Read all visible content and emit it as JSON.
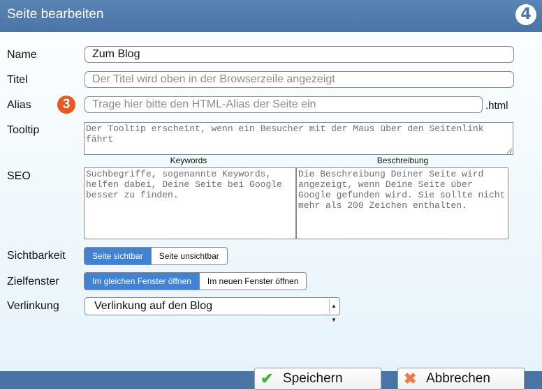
{
  "window": {
    "title": "Seite bearbeiten",
    "logo_text": "4"
  },
  "fields": {
    "name": {
      "label": "Name",
      "value": "Zum Blog"
    },
    "titel": {
      "label": "Titel",
      "placeholder": "Der Titel wird oben in der Browserzeile angezeigt"
    },
    "alias": {
      "label": "Alias",
      "placeholder": "Trage hier bitte den HTML-Alias der Seite ein",
      "suffix": ".html",
      "step_badge": "3"
    },
    "tooltip": {
      "label": "Tooltip",
      "placeholder": "Der Tooltip erscheint, wenn ein Besucher mit der Maus über den Seitenlink fährt"
    },
    "seo": {
      "label": "SEO",
      "keywords": {
        "heading": "Keywords",
        "placeholder": "Suchbegriffe, sogenannte Keywords, helfen dabei, Deine Seite bei Google besser zu finden."
      },
      "beschreibung": {
        "heading": "Beschreibung",
        "placeholder": "Die Beschreibung Deiner Seite wird angezeigt, wenn Deine Seite über Google gefunden wird. Sie sollte nicht mehr als 200 Zeichen enthalten."
      }
    },
    "sichtbarkeit": {
      "label": "Sichtbarkeit",
      "options": [
        "Seite sichtbar",
        "Seite unsichtbar"
      ],
      "selected": "Seite sichtbar"
    },
    "zielfenster": {
      "label": "Zielfenster",
      "options": [
        "Im gleichen Fenster öffnen",
        "Im neuen Fenster öffnen"
      ],
      "selected": "Im gleichen Fenster öffnen"
    },
    "verlinkung": {
      "label": "Verlinkung",
      "value": "Verlinkung auf den Blog"
    }
  },
  "buttons": {
    "save": {
      "label": "Speichern",
      "icon": "check-icon",
      "color": "#4cb23e"
    },
    "cancel": {
      "label": "Abbrechen",
      "icon": "cross-icon",
      "color": "#f07a4a"
    }
  },
  "colors": {
    "titlebar": "#4a74a6",
    "active_segment": "#3f82d6",
    "badge": "#e9581f",
    "background": "#e3f1fb"
  }
}
